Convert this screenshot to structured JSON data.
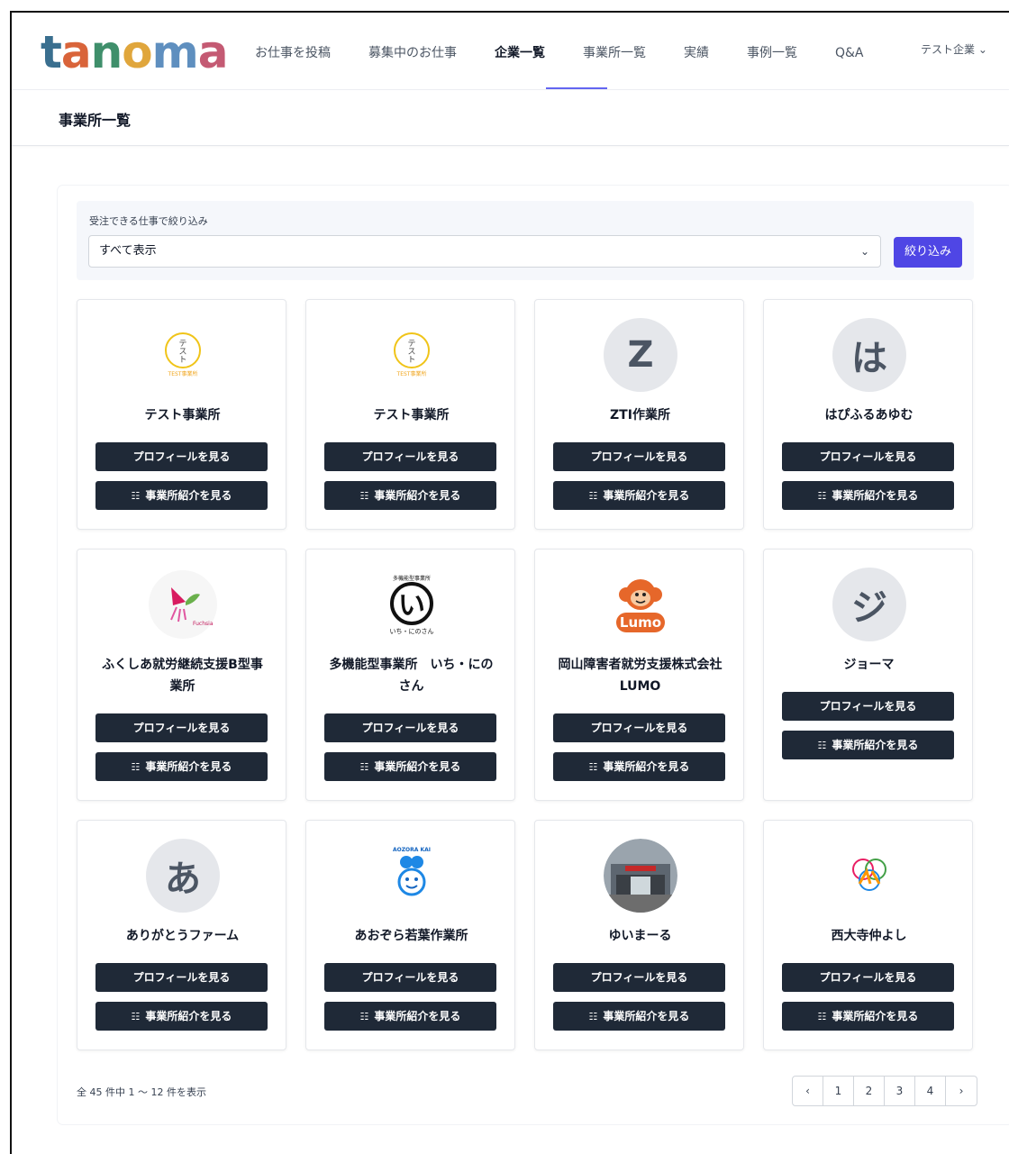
{
  "brand": {
    "logo_text": [
      "t",
      "a",
      "n",
      "o",
      "m",
      "a"
    ]
  },
  "nav": {
    "items": [
      {
        "label": "お仕事を投稿"
      },
      {
        "label": "募集中のお仕事"
      },
      {
        "label": "企業一覧"
      },
      {
        "label": "事業所一覧"
      },
      {
        "label": "実績"
      },
      {
        "label": "事例一覧"
      },
      {
        "label": "Q&A"
      }
    ],
    "user_label": "テスト企業",
    "user_chevron": "⌄"
  },
  "page": {
    "title": "事業所一覧"
  },
  "filter": {
    "label": "受注できる仕事で絞り込み",
    "selected": "すべて表示",
    "button": "絞り込み"
  },
  "cards": [
    {
      "name": "テスト事業所",
      "avatar": "テスト",
      "avatar_type": "logo-test"
    },
    {
      "name": "テスト事業所",
      "avatar": "テスト",
      "avatar_type": "logo-test"
    },
    {
      "name": "ZTI作業所",
      "avatar": "Z",
      "avatar_type": "letter"
    },
    {
      "name": "はぴふるあゆむ",
      "avatar": "は",
      "avatar_type": "letter"
    },
    {
      "name": "ふくしあ就労継続支援B型事業所",
      "avatar": "Fuchsia",
      "avatar_type": "logo-flower"
    },
    {
      "name": "多機能型事業所　いち・にのさん",
      "avatar": "い",
      "avatar_type": "logo-i"
    },
    {
      "name": "岡山障害者就労支援株式会社LUMO",
      "avatar": "Lumo",
      "avatar_type": "logo-lumo"
    },
    {
      "name": "ジョーマ",
      "avatar": "ジ",
      "avatar_type": "letter"
    },
    {
      "name": "ありがとうファーム",
      "avatar": "あ",
      "avatar_type": "letter"
    },
    {
      "name": "あおぞら若葉作業所",
      "avatar": "AOZORA KAI",
      "avatar_type": "logo-aozora"
    },
    {
      "name": "ゆいまーる",
      "avatar": "photo",
      "avatar_type": "logo-photo"
    },
    {
      "name": "西大寺仲よし",
      "avatar": "",
      "avatar_type": "logo-nakayoshi"
    }
  ],
  "card_buttons": {
    "profile": "プロフィールを見る",
    "intro": "事業所紹介を見る"
  },
  "pagination": {
    "summary": "全 45 件中 1 〜 12 件を表示",
    "prev": "‹",
    "pages": [
      "1",
      "2",
      "3",
      "4"
    ],
    "next": "›"
  }
}
